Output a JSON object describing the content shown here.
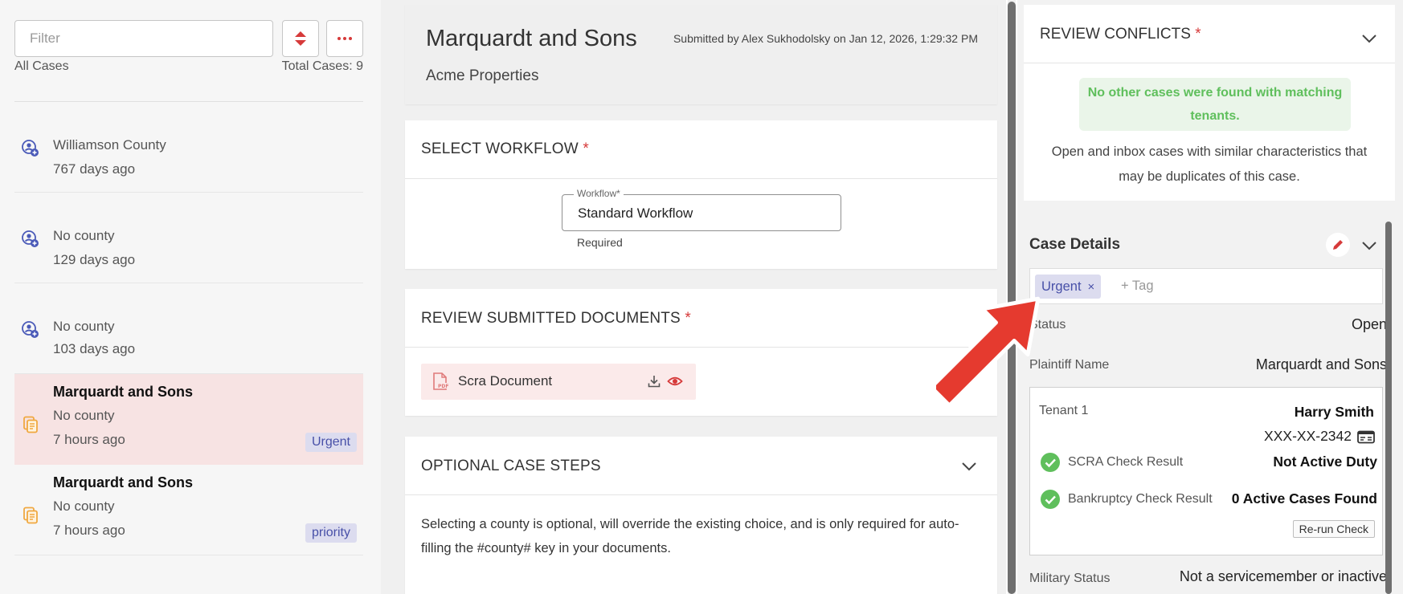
{
  "sidebar": {
    "filter_placeholder": "Filter",
    "filter_value": "",
    "all_cases_label": "All Cases",
    "total_cases_label": "Total Cases: 9",
    "cases": [
      {
        "title": "",
        "line1": "Williamson County",
        "line2": "767 days ago",
        "tag": "",
        "icon": "case-person-icon",
        "selected": false
      },
      {
        "title": "",
        "line1": "No county",
        "line2": "129 days ago",
        "tag": "",
        "icon": "case-person-icon",
        "selected": false
      },
      {
        "title": "",
        "line1": "No county",
        "line2": "103 days ago",
        "tag": "",
        "icon": "case-person-icon",
        "selected": false
      },
      {
        "title": "Marquardt and Sons",
        "line1": "No county",
        "line2": "7 hours ago",
        "tag": "Urgent",
        "icon": "copy-document-icon",
        "selected": true
      },
      {
        "title": "Marquardt and Sons",
        "line1": "No county",
        "line2": "7 hours ago",
        "tag": "priority",
        "icon": "copy-document-icon",
        "selected": false
      }
    ]
  },
  "header": {
    "case_name": "Marquardt and Sons",
    "organization": "Acme Properties",
    "submitted_text": "Submitted by Alex Sukhodolsky on Jan 12, 2026, 1:29:32 PM"
  },
  "workflow": {
    "section_title": "SELECT WORKFLOW",
    "required_mark": "*",
    "field_label": "Workflow*",
    "field_value": "Standard Workflow",
    "helper_text": "Required"
  },
  "documents": {
    "section_title": "REVIEW SUBMITTED DOCUMENTS",
    "required_mark": "*",
    "items": [
      {
        "name": "Scra Document"
      }
    ]
  },
  "optional_steps": {
    "section_title": "OPTIONAL CASE STEPS",
    "description": "Selecting a county is optional, will override the existing choice, and is only required for auto-filling the #county# key in your documents."
  },
  "conflicts": {
    "section_title": "REVIEW CONFLICTS",
    "required_mark": "*",
    "message": "No other cases were found with matching tenants.",
    "note": "Open and inbox cases with similar characteristics that may be duplicates of this case."
  },
  "case_details": {
    "title": "Case Details",
    "tags": [
      "Urgent"
    ],
    "tag_remove_symbol": "×",
    "add_tag_label": "+ Tag",
    "status_label": "Status",
    "status_value": "Open",
    "plaintiff_label": "Plaintiff Name",
    "plaintiff_value": "Marquardt and Sons",
    "tenant": {
      "label": "Tenant 1",
      "name": "Harry Smith",
      "ssn": "XXX-XX-2342",
      "scra_label": "SCRA Check Result",
      "scra_result": "Not Active Duty",
      "bankruptcy_label": "Bankruptcy Check Result",
      "bankruptcy_result": "0 Active Cases Found",
      "rerun_label": "Re-run Check"
    },
    "military_label": "Military Status",
    "military_value": "Not a servicemember or inactive"
  },
  "colors": {
    "accent_red": "#d63a3a",
    "tag_bg": "#dcdcef",
    "tag_text": "#4850a8",
    "success_green": "#5fbf5c",
    "selected_row": "#f7e3e3",
    "case_icon_blue": "#4a5ab8",
    "case_icon_orange": "#f0a840"
  }
}
